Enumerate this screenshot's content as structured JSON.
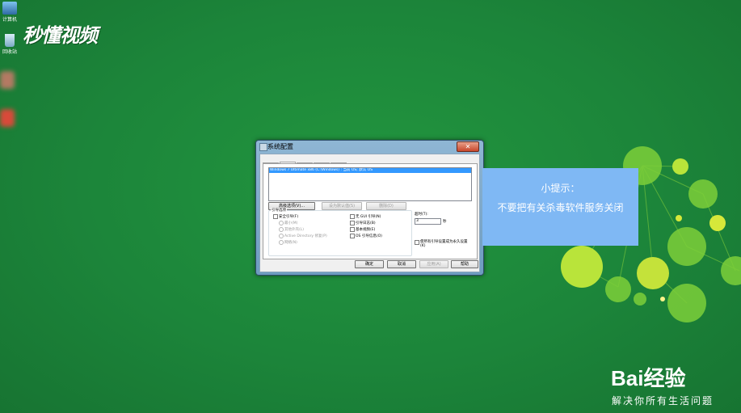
{
  "desktop": {
    "icons": [
      {
        "label": "计算机"
      },
      {
        "label": "回收站"
      }
    ]
  },
  "watermark": {
    "logo_text": "秒懂视频"
  },
  "dialog": {
    "title": "系统配置",
    "close_label": "✕",
    "tabs": [
      "常规",
      "引导",
      "服务",
      "启动",
      "工具"
    ],
    "active_tab": "引导",
    "os_entry": "Windows 7 Ultimate x86 (C:\\Windows) : 当前 OS; 默认 OS",
    "buttons": {
      "advanced": "高级选项(V)...",
      "set_default": "设为默认值(S)",
      "delete": "删除(D)"
    },
    "boot_options": {
      "group_label": "引导选项",
      "safe_boot": "安全引导(F)",
      "minimal": "最小(M)",
      "alternate_shell": "其他外壳(L)",
      "active_directory": "Active Directory 修复(P)",
      "network": "网络(N)",
      "no_gui": "无 GUI 引导(N)",
      "boot_log": "引导日志(B)",
      "base_video": "基本视频(E)",
      "os_info": "OS 引导信息(O)"
    },
    "timeout": {
      "label": "超时(T):",
      "value": "3",
      "unit": "秒"
    },
    "make_permanent": "使所有引导设置成为永久设置(K)",
    "footer": {
      "ok": "确定",
      "cancel": "取消",
      "apply": "应用(A)",
      "help": "帮助"
    }
  },
  "tip": {
    "heading": "小提示：",
    "text": "不要把有关杀毒软件服务关闭"
  },
  "brand": {
    "name": "Bai经验",
    "tagline": "解决你所有生活问题"
  },
  "colors": {
    "desktop_bg": "#1e8a3e",
    "tip_bg": "#7fb8f4",
    "selection": "#3399ff",
    "close_red": "#c8472c"
  }
}
